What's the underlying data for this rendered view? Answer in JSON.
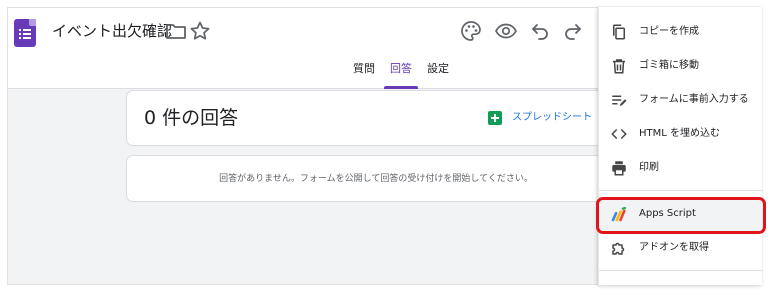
{
  "header": {
    "title": "イベント出欠確認",
    "icons": [
      "forms-app-icon",
      "folder-icon",
      "star-icon",
      "palette-icon",
      "eye-icon",
      "undo-icon",
      "redo-icon"
    ]
  },
  "tabs": [
    {
      "label": "質問",
      "active": false
    },
    {
      "label": "回答",
      "active": true
    },
    {
      "label": "設定",
      "active": false
    }
  ],
  "summary": {
    "count_text": "0 件の回答",
    "sheets_link": "スプレッドシート"
  },
  "empty_message": "回答がありません。フォームを公開して回答の受け付けを開始してください。",
  "menu": {
    "items": [
      {
        "label": "コピーを作成",
        "icon": "copy-icon"
      },
      {
        "label": "ゴミ箱に移動",
        "icon": "trash-icon"
      },
      {
        "label": "フォームに事前入力する",
        "icon": "prefill-icon"
      },
      {
        "label": "HTML を埋め込む",
        "icon": "code-icon"
      },
      {
        "label": "印刷",
        "icon": "print-icon"
      },
      {
        "label": "Apps Script",
        "icon": "apps-script-icon"
      },
      {
        "label": "アドオンを取得",
        "icon": "addon-icon"
      }
    ],
    "highlighted": "Apps Script"
  },
  "colors": {
    "brand": "#673ab7",
    "link": "#1a73e8",
    "sheets": "#0f9d58",
    "highlight_box": "#e0151b",
    "background": "#f1f3f4"
  }
}
